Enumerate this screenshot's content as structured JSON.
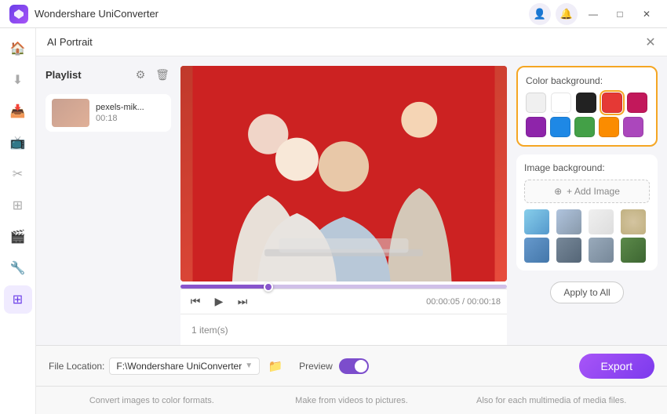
{
  "app": {
    "title": "Wondershare UniConverter",
    "logo_color": "#7c3aed"
  },
  "titlebar": {
    "minimize_label": "—",
    "maximize_label": "□",
    "close_label": "✕",
    "user_icon": "👤",
    "bell_icon": "🔔"
  },
  "ai_portrait": {
    "label": "AI Portrait",
    "close_icon": "✕"
  },
  "sidebar": {
    "icons": [
      "🏠",
      "⬇",
      "📥",
      "📺",
      "✂",
      "⊞",
      "🎬",
      "🔧",
      "⊞"
    ]
  },
  "playlist": {
    "label": "Playlist",
    "settings_icon": "⚙",
    "delete_icon": "🗑",
    "items": [
      {
        "name": "pexels-mik...",
        "duration": "00:18"
      }
    ]
  },
  "video": {
    "progress_percent": 27,
    "current_time": "00:00:05",
    "total_time": "00:00:18",
    "prev_icon": "⏮",
    "play_icon": "▶",
    "next_icon": "⏭"
  },
  "bottom": {
    "items_count": "1 item(s)"
  },
  "color_background": {
    "label": "Color background:",
    "colors": [
      {
        "value": "#f0f0f0",
        "name": "light-gray"
      },
      {
        "value": "#ffffff",
        "name": "white"
      },
      {
        "value": "#222222",
        "name": "black"
      },
      {
        "value": "#e53935",
        "name": "red"
      },
      {
        "value": "#c2185b",
        "name": "dark-pink"
      },
      {
        "value": "#8e24aa",
        "name": "purple"
      },
      {
        "value": "#1e88e5",
        "name": "blue"
      },
      {
        "value": "#43a047",
        "name": "green"
      },
      {
        "value": "#fb8c00",
        "name": "orange"
      },
      {
        "value": "#ab47bc",
        "name": "light-purple"
      }
    ],
    "selected_color": "#e53935"
  },
  "image_background": {
    "label": "Image background:",
    "add_label": "+ Add Image",
    "thumbnails": [
      {
        "class": "image-thumb-1",
        "label": "sky"
      },
      {
        "class": "image-thumb-2",
        "label": "clouds"
      },
      {
        "class": "image-thumb-3",
        "label": "light"
      },
      {
        "class": "image-thumb-4",
        "label": "sand"
      },
      {
        "class": "image-thumb-5",
        "label": "ocean"
      },
      {
        "class": "image-thumb-6",
        "label": "dark"
      },
      {
        "class": "image-thumb-7",
        "label": "gray"
      },
      {
        "class": "image-thumb-8",
        "label": "forest"
      }
    ]
  },
  "apply_btn": {
    "label": "Apply to All"
  },
  "footer": {
    "file_location_label": "File Location:",
    "file_path": "F:\\Wondershare UniConverter",
    "preview_label": "Preview",
    "export_label": "Export"
  },
  "footer_strip": {
    "texts": [
      "Convert images to color formats.",
      "Make from videos to pictures.",
      "Also for each multimedia of media files."
    ]
  }
}
